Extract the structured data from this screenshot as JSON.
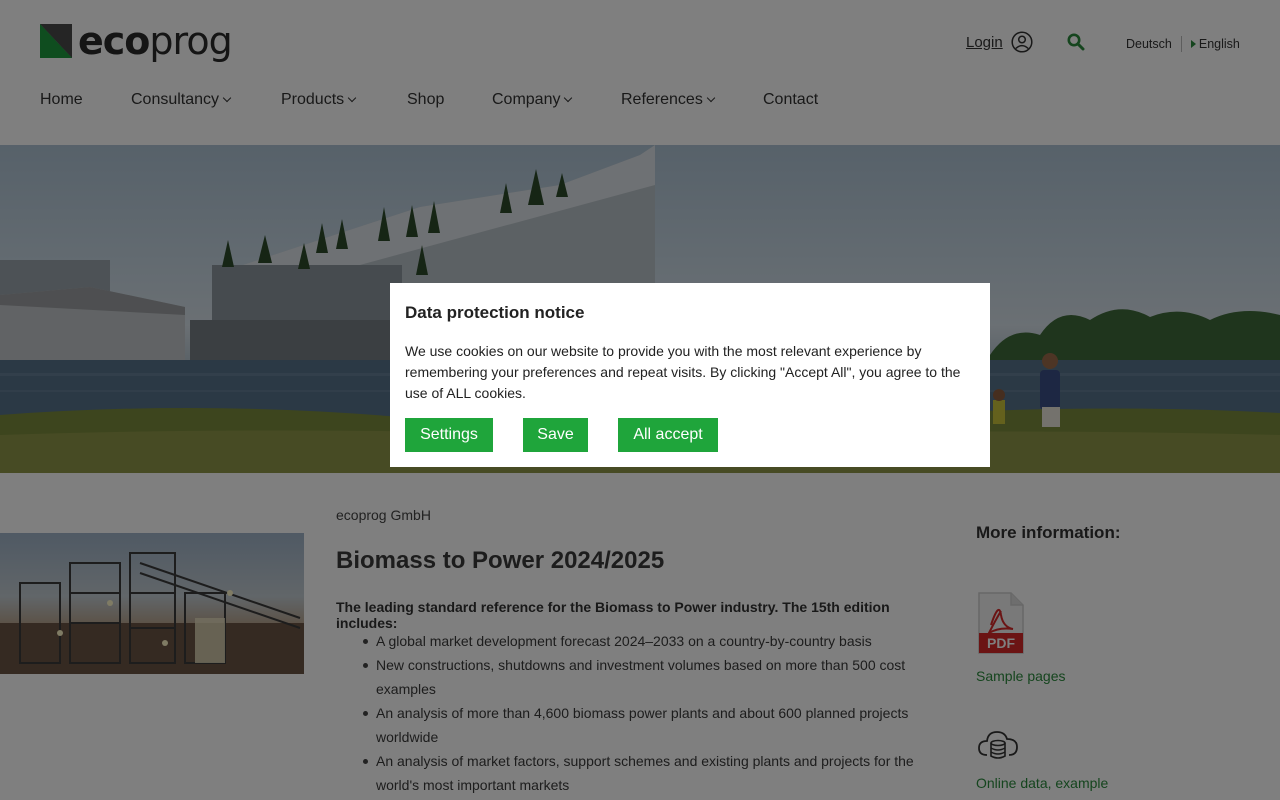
{
  "header": {
    "logo": {
      "prefix": "eco",
      "suffix": "prog"
    },
    "login_label": "Login",
    "languages": [
      {
        "label": "Deutsch",
        "active": false
      },
      {
        "label": "English",
        "active": true
      }
    ]
  },
  "nav": [
    {
      "label": "Home",
      "has_dropdown": false
    },
    {
      "label": "Consultancy",
      "has_dropdown": true
    },
    {
      "label": "Products",
      "has_dropdown": true
    },
    {
      "label": "Shop",
      "has_dropdown": false
    },
    {
      "label": "Company",
      "has_dropdown": true
    },
    {
      "label": "References",
      "has_dropdown": true
    },
    {
      "label": "Contact",
      "has_dropdown": false
    }
  ],
  "main": {
    "company": "ecoprog GmbH",
    "title": "Biomass to Power 2024/2025",
    "lead": "The leading standard reference for the Biomass to Power industry. The 15th edition includes:",
    "bullets": [
      "A global market development forecast 2024–2033 on a country-by-country basis",
      "New constructions, shutdowns and investment volumes based on more than 500 cost examples",
      "An analysis of more than 4,600 biomass power plants and about 600 planned projects worldwide",
      "An analysis of market factors, support schemes and existing plants and projects for the world's most important markets"
    ]
  },
  "sidebar": {
    "title": "More information:",
    "pdf_badge": "PDF",
    "links": [
      {
        "label": "Sample pages",
        "icon": "pdf-icon"
      },
      {
        "label": "Online data, example",
        "icon": "cloud-database-icon"
      }
    ]
  },
  "cookie_modal": {
    "title": "Data protection notice",
    "text": "We use cookies on our website to provide you with the most relevant experience by remembering your preferences and repeat visits. By clicking \"Accept All\", you agree to the use of ALL cookies.",
    "buttons": {
      "settings": "Settings",
      "save": "Save",
      "accept_all": "All accept"
    }
  },
  "colors": {
    "accent": "#1fa53b",
    "link": "#2a8a3c"
  }
}
